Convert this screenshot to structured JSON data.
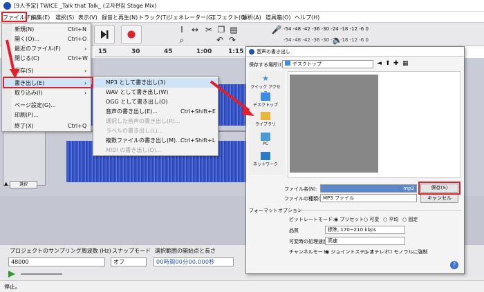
{
  "window": {
    "title": "[9人予定] TWICE _Talk that Talk_ (고자편집 Stage Mix)"
  },
  "menubar": {
    "items": [
      "ファイル(F)",
      "編集(E)",
      "選択(S)",
      "表示(V)",
      "録音と再生(N)",
      "トラック(T)",
      "ジェネレーター(G)",
      "エフェクト(C)",
      "解析(A)",
      "道具箱(O)",
      "ヘルプ(H)"
    ]
  },
  "meter": {
    "scale": "-54 -48 -42 -36 -30 -24 -18 -12 -6 0",
    "scale2": "-54 -48 -42 -36 -30 -24 -18 -12 -6 0"
  },
  "ruler": {
    "labels": [
      "15",
      "30",
      "45",
      "1:00",
      "1:15"
    ]
  },
  "file_menu": {
    "items": [
      {
        "label": "新規(N)",
        "shortcut": "Ctrl+N"
      },
      {
        "label": "開く(O)...",
        "shortcut": "Ctrl+O"
      },
      {
        "label": "最近のファイル(F)",
        "shortcut": ""
      },
      {
        "label": "閉じる(C)",
        "shortcut": "Ctrl+W"
      },
      {
        "label": "保存(S)",
        "shortcut": ""
      },
      {
        "label": "書き出し(E)",
        "shortcut": ""
      },
      {
        "label": "取り込み(I)",
        "shortcut": ""
      },
      {
        "label": "ページ設定(G)...",
        "shortcut": ""
      },
      {
        "label": "印刷(P)...",
        "shortcut": ""
      },
      {
        "label": "終了(X)",
        "shortcut": "Ctrl+Q"
      }
    ]
  },
  "export_menu": {
    "items": [
      {
        "label": "MP3 として書き出し(3)",
        "shortcut": "",
        "disabled": false
      },
      {
        "label": "WAV として書き出し(W)",
        "shortcut": "",
        "disabled": false
      },
      {
        "label": "OGG として書き出し(O)",
        "shortcut": "",
        "disabled": false
      },
      {
        "label": "音声の書き出し(E)...",
        "shortcut": "Ctrl+Shift+E",
        "disabled": false
      },
      {
        "label": "選択した音声の書き出し(R)...",
        "shortcut": "",
        "disabled": true
      },
      {
        "label": "ラベルの書き出し(L)...",
        "shortcut": "",
        "disabled": true
      },
      {
        "label": "複数ファイルの書き出し(M)...",
        "shortcut": "Ctrl+Shift+L",
        "disabled": false
      },
      {
        "label": "MIDI の書き出し(D)...",
        "shortcut": "",
        "disabled": true
      }
    ]
  },
  "track": {
    "select_label": "選択"
  },
  "selection_toolbar": {
    "rate_label": "プロジェクトのサンプリング周波数 (Hz)",
    "snap_label": "スナップモード",
    "range_label": "選択範囲の開始点と長さ",
    "rate_value": "48000",
    "snap_value": "オフ",
    "time_value": "00時間00分00.000秒"
  },
  "status": {
    "text": "停止。"
  },
  "dialog": {
    "title": "音声の書き出し",
    "location_label": "保存する場所(I):",
    "location_value": "デスクトップ",
    "places": [
      "クイック アクセス",
      "デスクトップ",
      "ライブラリ",
      "PC",
      "ネットワーク"
    ],
    "filename_label": "ファイル名(N):",
    "filename_suffix": "mp3",
    "filetype_label": "ファイルの種類(T):",
    "filetype_value": "MP3 ファイル",
    "save_button": "保存(S)",
    "cancel_button": "キャンセル",
    "format_options_label": "フォーマットオプション",
    "bitrate_label": "ビットレートモード:",
    "bitrate_options": [
      "プリセット",
      "可変",
      "平均",
      "固定"
    ],
    "quality_label": "品質",
    "quality_value": "標準, 170~210 kbps",
    "speed_label": "可変時の処理速度:",
    "speed_value": "高速",
    "channel_label": "チャンネルモード:",
    "channel_options": [
      "ジョイントステレオ",
      "ステレオ"
    ],
    "mono_label": "モノラルに強制"
  },
  "colors": {
    "accent_red": "#e0202b",
    "waveform": "#3a57c9",
    "highlight": "#cfe3f7"
  }
}
